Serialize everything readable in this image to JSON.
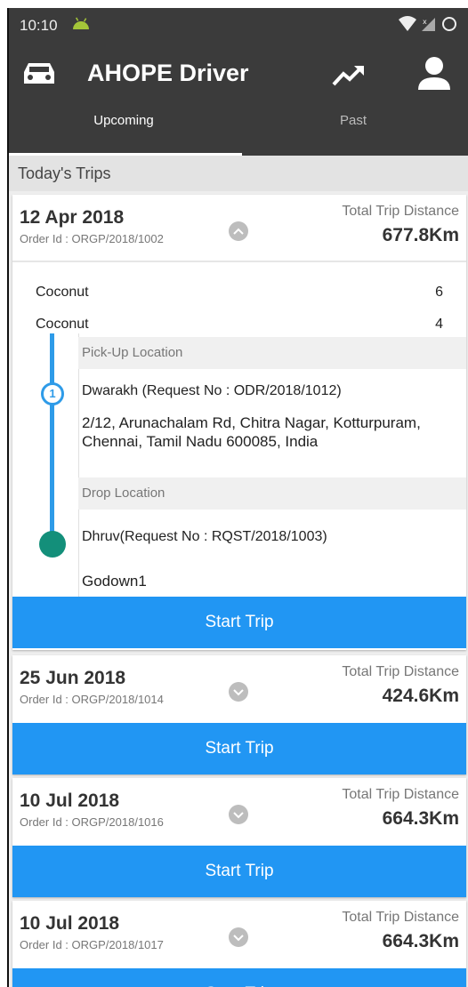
{
  "status_bar": {
    "time": "10:10"
  },
  "app_bar": {
    "title": "AHOPE Driver"
  },
  "tabs": [
    {
      "label": "Upcoming",
      "active": true
    },
    {
      "label": "Past",
      "active": false
    }
  ],
  "section_title": "Today's Trips",
  "colors": {
    "header": "#3b3b3b",
    "accent": "#2196f3",
    "timeline": "#2e9be8",
    "drop_marker": "#138f7a"
  },
  "distance_label": "Total Trip Distance",
  "trips": [
    {
      "date": "12 Apr 2018",
      "order_id": "Order Id : ORGP/2018/1002",
      "distance": "677.8Km",
      "expanded": true,
      "items": [
        {
          "name": "Coconut",
          "qty": "6"
        },
        {
          "name": "Coconut",
          "qty": "4"
        }
      ],
      "pickup": {
        "label": "Pick-Up Location",
        "step": "1",
        "name": "Dwarakh (Request No : ODR/2018/1012)",
        "address": "2/12, Arunachalam Rd, Chitra Nagar, Kotturpuram, Chennai, Tamil Nadu 600085, India"
      },
      "drop": {
        "label": "Drop Location",
        "name": "Dhruv(Request No : RQST/2018/1003)",
        "address": "Godown1"
      },
      "button": "Start Trip"
    },
    {
      "date": "25 Jun 2018",
      "order_id": "Order Id : ORGP/2018/1014",
      "distance": "424.6Km",
      "expanded": false,
      "button": "Start Trip"
    },
    {
      "date": "10 Jul 2018",
      "order_id": "Order Id : ORGP/2018/1016",
      "distance": "664.3Km",
      "expanded": false,
      "button": "Start Trip"
    },
    {
      "date": "10 Jul 2018",
      "order_id": "Order Id : ORGP/2018/1017",
      "distance": "664.3Km",
      "expanded": false,
      "button": "Start Trip"
    }
  ]
}
